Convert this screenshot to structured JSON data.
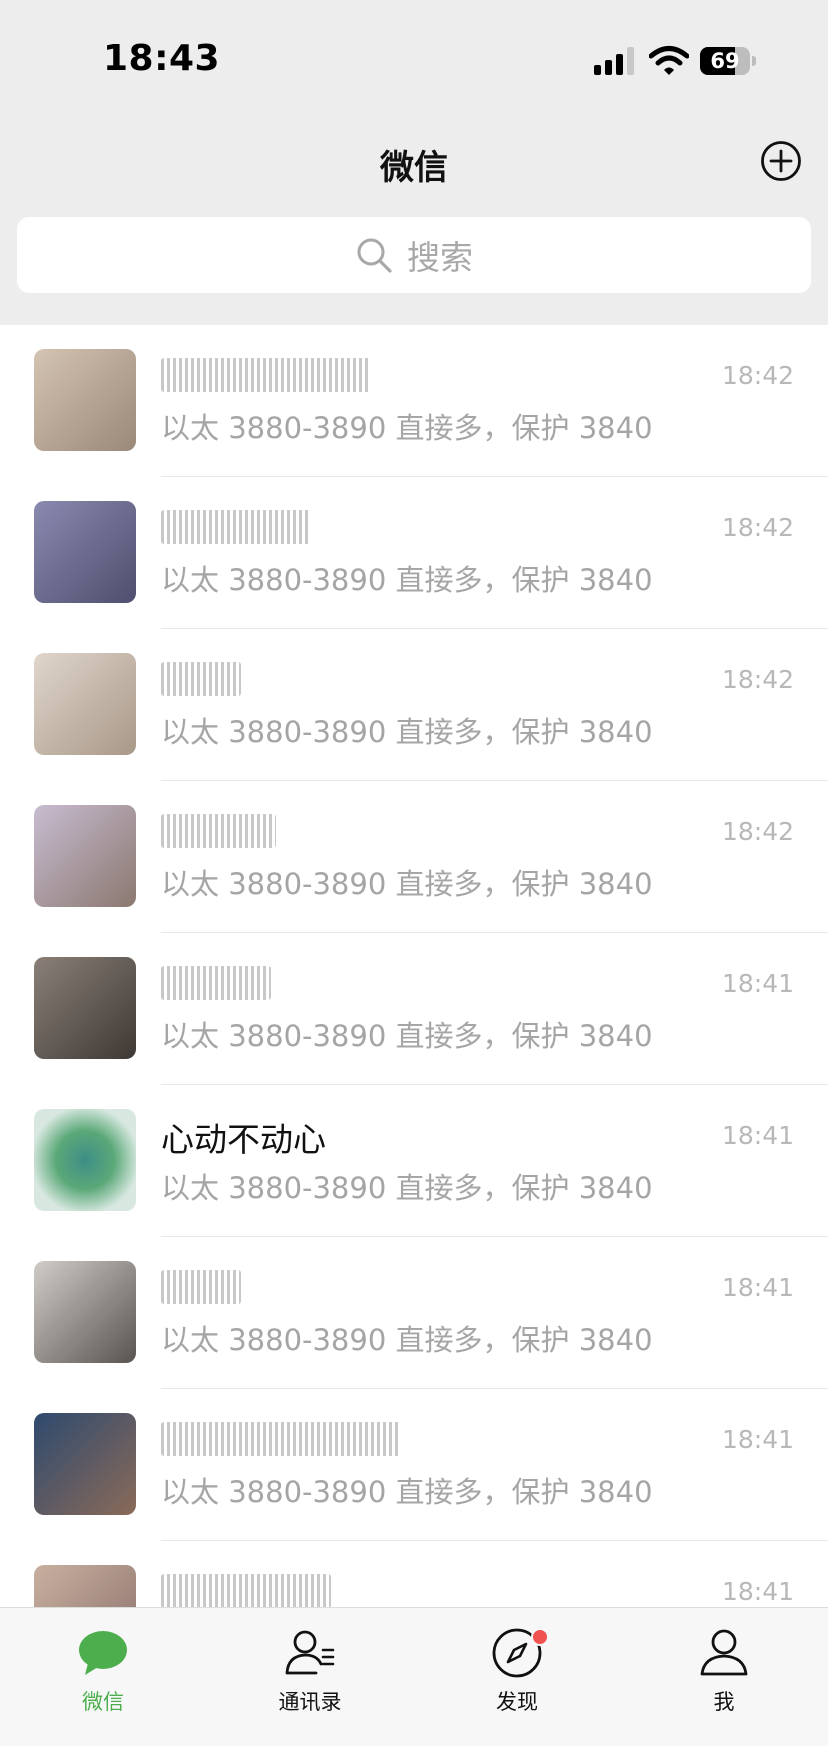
{
  "status_bar": {
    "time": "18:43",
    "battery_level": "69",
    "signal_icon": "cellular-signal-icon",
    "wifi_icon": "wifi-icon"
  },
  "header": {
    "title": "微信",
    "add_icon": "plus-circle-icon"
  },
  "search": {
    "placeholder": "搜索",
    "icon": "search-icon"
  },
  "chats": [
    {
      "name": "",
      "message": "以太 3880-3890 直接多，保护 3840",
      "time": "18:42",
      "avatar_color": "#b8a898"
    },
    {
      "name": "",
      "message": "以太 3880-3890 直接多，保护 3840",
      "time": "18:42",
      "avatar_color": "#6b6c8e"
    },
    {
      "name": "",
      "message": "以太 3880-3890 直接多，保护 3840",
      "time": "18:42",
      "avatar_color": "#c9b9a8"
    },
    {
      "name": "",
      "message": "以太 3880-3890 直接多，保护 3840",
      "time": "18:42",
      "avatar_color": "#a89890"
    },
    {
      "name": "",
      "message": "以太 3880-3890 直接多，保护 3840",
      "time": "18:41",
      "avatar_color": "#6e6660"
    },
    {
      "name": "心动不动心",
      "message": "以太 3880-3890 直接多，保护 3840",
      "time": "18:41",
      "avatar_color": "#4c9a7a"
    },
    {
      "name": "",
      "message": "以太 3880-3890 直接多，保护 3840",
      "time": "18:41",
      "avatar_color": "#8a8680"
    },
    {
      "name": "",
      "message": "以太 3880-3890 直接多，保护 3840",
      "time": "18:41",
      "avatar_color": "#5a5a6a"
    },
    {
      "name": "",
      "message": "",
      "time": "18:41",
      "avatar_color": "#a4908a"
    }
  ],
  "tabs": [
    {
      "label": "微信",
      "icon": "chat-bubble-icon",
      "active": true
    },
    {
      "label": "通讯录",
      "icon": "contacts-icon",
      "active": false
    },
    {
      "label": "发现",
      "icon": "compass-icon",
      "active": false,
      "badge": true
    },
    {
      "label": "我",
      "icon": "person-icon",
      "active": false
    }
  ],
  "colors": {
    "accent_green": "#4cae4c",
    "badge_red": "#f05252",
    "background": "#ededed"
  }
}
